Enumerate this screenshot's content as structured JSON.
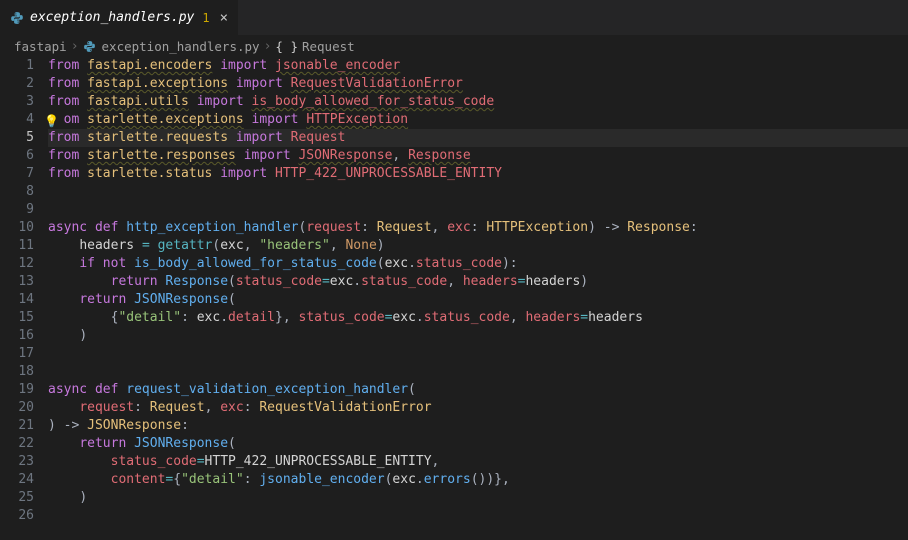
{
  "tab": {
    "icon": "python-icon",
    "filename": "exception_handlers.py",
    "badge": "1",
    "close": "×"
  },
  "breadcrumbs": {
    "seg1": "fastapi",
    "seg2": "exception_handlers.py",
    "braces": "{ }",
    "seg3": "Request",
    "sep": "›"
  },
  "gutter_active_line": 5,
  "lines": [
    {
      "n": 1,
      "tokens": [
        {
          "c": "kw",
          "t": "from"
        },
        {
          "c": "",
          "t": " "
        },
        {
          "c": "mod",
          "t": "fastapi.encoders"
        },
        {
          "c": "",
          "t": " "
        },
        {
          "c": "kw",
          "t": "import"
        },
        {
          "c": "",
          "t": " "
        },
        {
          "c": "lit-import",
          "t": "jsonable_encoder"
        }
      ]
    },
    {
      "n": 2,
      "tokens": [
        {
          "c": "kw",
          "t": "from"
        },
        {
          "c": "",
          "t": " "
        },
        {
          "c": "mod",
          "t": "fastapi.exceptions"
        },
        {
          "c": "",
          "t": " "
        },
        {
          "c": "kw",
          "t": "import"
        },
        {
          "c": "",
          "t": " "
        },
        {
          "c": "lit-import",
          "t": "RequestValidationError"
        }
      ]
    },
    {
      "n": 3,
      "tokens": [
        {
          "c": "kw",
          "t": "from"
        },
        {
          "c": "",
          "t": " "
        },
        {
          "c": "mod",
          "t": "fastapi.utils"
        },
        {
          "c": "",
          "t": " "
        },
        {
          "c": "kw",
          "t": "import"
        },
        {
          "c": "",
          "t": " "
        },
        {
          "c": "lit-import",
          "t": "is_body_allowed_for_status_code"
        }
      ]
    },
    {
      "n": 4,
      "bulb": true,
      "tokens": [
        {
          "c": "kw",
          "t": "  om"
        },
        {
          "c": "",
          "t": " "
        },
        {
          "c": "mod",
          "t": "starlette.exceptions"
        },
        {
          "c": "",
          "t": " "
        },
        {
          "c": "kw",
          "t": "import"
        },
        {
          "c": "",
          "t": " "
        },
        {
          "c": "lit-import",
          "t": "HTTPException"
        }
      ]
    },
    {
      "n": 5,
      "active": true,
      "tokens": [
        {
          "c": "kw",
          "t": "from"
        },
        {
          "c": "",
          "t": " "
        },
        {
          "c": "plain-mod",
          "t": "starlette.requests"
        },
        {
          "c": "",
          "t": " "
        },
        {
          "c": "kw",
          "t": "import"
        },
        {
          "c": "",
          "t": " "
        },
        {
          "c": "name",
          "t": "Request"
        }
      ]
    },
    {
      "n": 6,
      "tokens": [
        {
          "c": "kw",
          "t": "from"
        },
        {
          "c": "",
          "t": " "
        },
        {
          "c": "mod",
          "t": "starlette.responses"
        },
        {
          "c": "",
          "t": " "
        },
        {
          "c": "kw",
          "t": "import"
        },
        {
          "c": "",
          "t": " "
        },
        {
          "c": "lit-import",
          "t": "JSONResponse"
        },
        {
          "c": "punct",
          "t": ", "
        },
        {
          "c": "lit-import",
          "t": "Response"
        }
      ]
    },
    {
      "n": 7,
      "tokens": [
        {
          "c": "kw",
          "t": "from"
        },
        {
          "c": "",
          "t": " "
        },
        {
          "c": "plain-mod",
          "t": "starlette.status"
        },
        {
          "c": "",
          "t": " "
        },
        {
          "c": "kw",
          "t": "import"
        },
        {
          "c": "",
          "t": " "
        },
        {
          "c": "name",
          "t": "HTTP_422_UNPROCESSABLE_ENTITY"
        }
      ]
    },
    {
      "n": 8,
      "tokens": []
    },
    {
      "n": 9,
      "tokens": []
    },
    {
      "n": 10,
      "tokens": [
        {
          "c": "kw",
          "t": "async"
        },
        {
          "c": "",
          "t": " "
        },
        {
          "c": "kw",
          "t": "def"
        },
        {
          "c": "",
          "t": " "
        },
        {
          "c": "df",
          "t": "http_exception_handler"
        },
        {
          "c": "punct",
          "t": "("
        },
        {
          "c": "param",
          "t": "request"
        },
        {
          "c": "punct",
          "t": ": "
        },
        {
          "c": "typ",
          "t": "Request"
        },
        {
          "c": "punct",
          "t": ", "
        },
        {
          "c": "param",
          "t": "exc"
        },
        {
          "c": "punct",
          "t": ": "
        },
        {
          "c": "typ",
          "t": "HTTPException"
        },
        {
          "c": "punct",
          "t": ") "
        },
        {
          "c": "punct",
          "t": "-> "
        },
        {
          "c": "typ",
          "t": "Response"
        },
        {
          "c": "punct",
          "t": ":"
        }
      ]
    },
    {
      "n": 11,
      "tokens": [
        {
          "c": "",
          "t": "    "
        },
        {
          "c": "",
          "t": "headers "
        },
        {
          "c": "op",
          "t": "="
        },
        {
          "c": "",
          "t": " "
        },
        {
          "c": "builtin",
          "t": "getattr"
        },
        {
          "c": "punct",
          "t": "("
        },
        {
          "c": "",
          "t": "exc"
        },
        {
          "c": "punct",
          "t": ", "
        },
        {
          "c": "str",
          "t": "\"headers\""
        },
        {
          "c": "punct",
          "t": ", "
        },
        {
          "c": "const",
          "t": "None"
        },
        {
          "c": "punct",
          "t": ")"
        }
      ]
    },
    {
      "n": 12,
      "tokens": [
        {
          "c": "",
          "t": "    "
        },
        {
          "c": "kw",
          "t": "if"
        },
        {
          "c": "",
          "t": " "
        },
        {
          "c": "kw",
          "t": "not"
        },
        {
          "c": "",
          "t": " "
        },
        {
          "c": "fn",
          "t": "is_body_allowed_for_status_code"
        },
        {
          "c": "punct",
          "t": "("
        },
        {
          "c": "",
          "t": "exc"
        },
        {
          "c": "punct",
          "t": "."
        },
        {
          "c": "prop",
          "t": "status_code"
        },
        {
          "c": "punct",
          "t": "):"
        }
      ]
    },
    {
      "n": 13,
      "tokens": [
        {
          "c": "",
          "t": "        "
        },
        {
          "c": "kw",
          "t": "return"
        },
        {
          "c": "",
          "t": " "
        },
        {
          "c": "fn",
          "t": "Response"
        },
        {
          "c": "punct",
          "t": "("
        },
        {
          "c": "param",
          "t": "status_code"
        },
        {
          "c": "op",
          "t": "="
        },
        {
          "c": "",
          "t": "exc"
        },
        {
          "c": "punct",
          "t": "."
        },
        {
          "c": "prop",
          "t": "status_code"
        },
        {
          "c": "punct",
          "t": ", "
        },
        {
          "c": "param",
          "t": "headers"
        },
        {
          "c": "op",
          "t": "="
        },
        {
          "c": "",
          "t": "headers"
        },
        {
          "c": "punct",
          "t": ")"
        }
      ]
    },
    {
      "n": 14,
      "tokens": [
        {
          "c": "",
          "t": "    "
        },
        {
          "c": "kw",
          "t": "return"
        },
        {
          "c": "",
          "t": " "
        },
        {
          "c": "fn",
          "t": "JSONResponse"
        },
        {
          "c": "punct",
          "t": "("
        }
      ]
    },
    {
      "n": 15,
      "tokens": [
        {
          "c": "",
          "t": "        "
        },
        {
          "c": "punct",
          "t": "{"
        },
        {
          "c": "str",
          "t": "\"detail\""
        },
        {
          "c": "punct",
          "t": ": "
        },
        {
          "c": "",
          "t": "exc"
        },
        {
          "c": "punct",
          "t": "."
        },
        {
          "c": "prop",
          "t": "detail"
        },
        {
          "c": "punct",
          "t": "}, "
        },
        {
          "c": "param",
          "t": "status_code"
        },
        {
          "c": "op",
          "t": "="
        },
        {
          "c": "",
          "t": "exc"
        },
        {
          "c": "punct",
          "t": "."
        },
        {
          "c": "prop",
          "t": "status_code"
        },
        {
          "c": "punct",
          "t": ", "
        },
        {
          "c": "param",
          "t": "headers"
        },
        {
          "c": "op",
          "t": "="
        },
        {
          "c": "",
          "t": "headers"
        }
      ]
    },
    {
      "n": 16,
      "tokens": [
        {
          "c": "",
          "t": "    "
        },
        {
          "c": "punct",
          "t": ")"
        }
      ]
    },
    {
      "n": 17,
      "tokens": []
    },
    {
      "n": 18,
      "tokens": []
    },
    {
      "n": 19,
      "tokens": [
        {
          "c": "kw",
          "t": "async"
        },
        {
          "c": "",
          "t": " "
        },
        {
          "c": "kw",
          "t": "def"
        },
        {
          "c": "",
          "t": " "
        },
        {
          "c": "df",
          "t": "request_validation_exception_handler"
        },
        {
          "c": "punct",
          "t": "("
        }
      ]
    },
    {
      "n": 20,
      "tokens": [
        {
          "c": "",
          "t": "    "
        },
        {
          "c": "param",
          "t": "request"
        },
        {
          "c": "punct",
          "t": ": "
        },
        {
          "c": "typ",
          "t": "Request"
        },
        {
          "c": "punct",
          "t": ", "
        },
        {
          "c": "param",
          "t": "exc"
        },
        {
          "c": "punct",
          "t": ": "
        },
        {
          "c": "typ",
          "t": "RequestValidationError"
        }
      ]
    },
    {
      "n": 21,
      "tokens": [
        {
          "c": "punct",
          "t": ") "
        },
        {
          "c": "punct",
          "t": "-> "
        },
        {
          "c": "typ",
          "t": "JSONResponse"
        },
        {
          "c": "punct",
          "t": ":"
        }
      ]
    },
    {
      "n": 22,
      "tokens": [
        {
          "c": "",
          "t": "    "
        },
        {
          "c": "kw",
          "t": "return"
        },
        {
          "c": "",
          "t": " "
        },
        {
          "c": "fn",
          "t": "JSONResponse"
        },
        {
          "c": "punct",
          "t": "("
        }
      ]
    },
    {
      "n": 23,
      "tokens": [
        {
          "c": "",
          "t": "        "
        },
        {
          "c": "param",
          "t": "status_code"
        },
        {
          "c": "op",
          "t": "="
        },
        {
          "c": "",
          "t": "HTTP_422_UNPROCESSABLE_ENTITY"
        },
        {
          "c": "punct",
          "t": ","
        }
      ]
    },
    {
      "n": 24,
      "tokens": [
        {
          "c": "",
          "t": "        "
        },
        {
          "c": "param",
          "t": "content"
        },
        {
          "c": "op",
          "t": "="
        },
        {
          "c": "punct",
          "t": "{"
        },
        {
          "c": "str",
          "t": "\"detail\""
        },
        {
          "c": "punct",
          "t": ": "
        },
        {
          "c": "fn",
          "t": "jsonable_encoder"
        },
        {
          "c": "punct",
          "t": "("
        },
        {
          "c": "",
          "t": "exc"
        },
        {
          "c": "punct",
          "t": "."
        },
        {
          "c": "fn",
          "t": "errors"
        },
        {
          "c": "punct",
          "t": "())},"
        }
      ]
    },
    {
      "n": 25,
      "tokens": [
        {
          "c": "",
          "t": "    "
        },
        {
          "c": "punct",
          "t": ")"
        }
      ]
    },
    {
      "n": 26,
      "tokens": []
    }
  ]
}
